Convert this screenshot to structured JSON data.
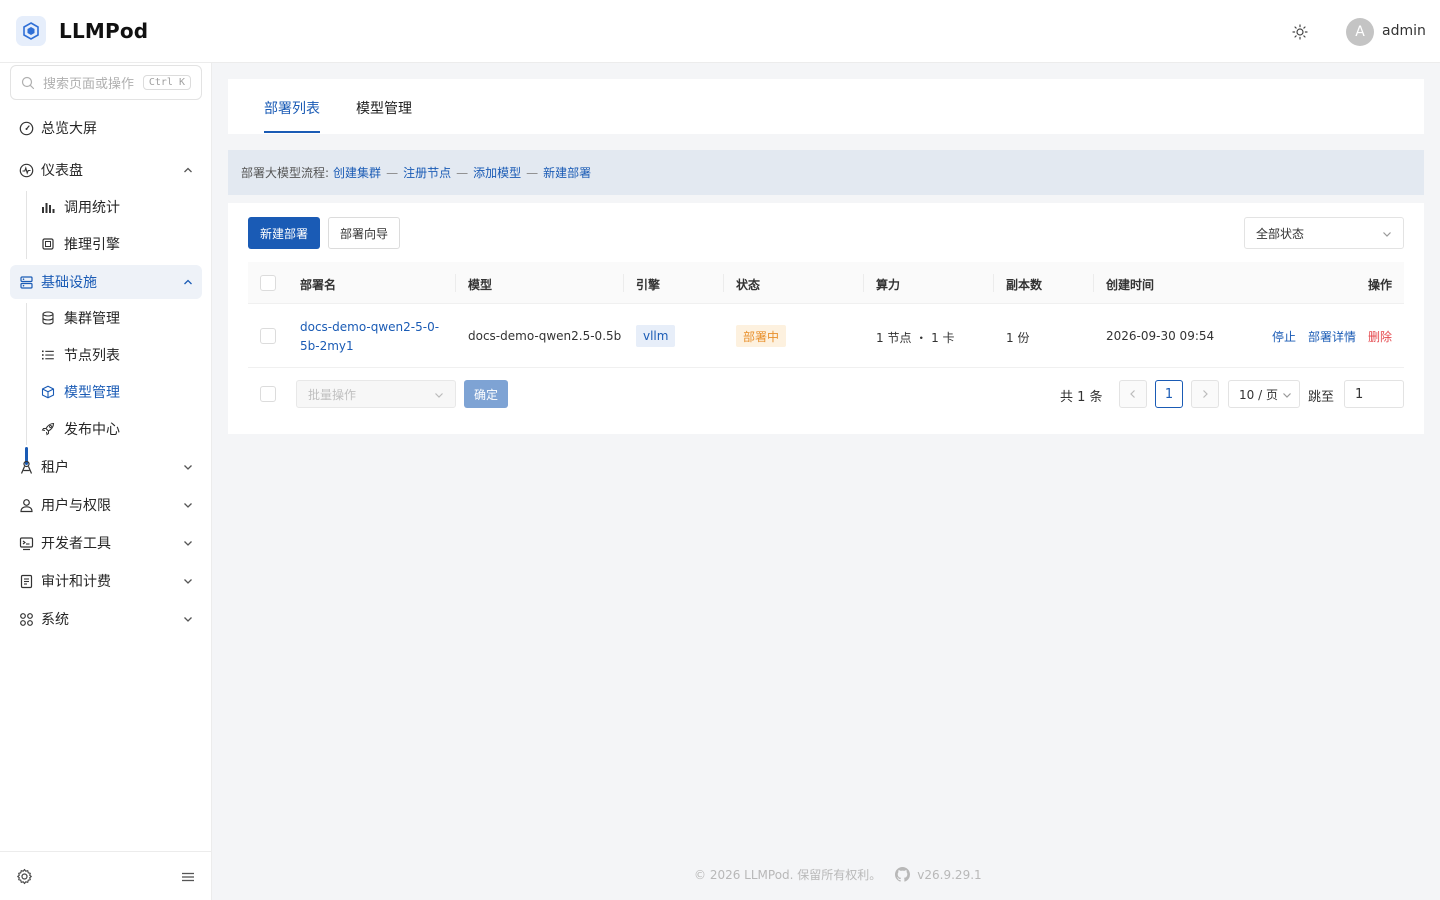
{
  "app": {
    "title": "LLMPod",
    "user_initial": "A",
    "username": "admin"
  },
  "search": {
    "placeholder": "搜索页面或操作",
    "shortcut": "Ctrl K"
  },
  "sidebar": {
    "overview": "总览大屏",
    "dashboard": {
      "label": "仪表盘",
      "children": [
        "调用统计",
        "推理引擎"
      ]
    },
    "infra": {
      "label": "基础设施",
      "children": [
        "集群管理",
        "节点列表",
        "模型管理",
        "发布中心"
      ]
    },
    "tenant": "租户",
    "users": "用户与权限",
    "devtools": "开发者工具",
    "audit": "审计和计费",
    "system": "系统"
  },
  "tabs": [
    "部署列表",
    "模型管理"
  ],
  "flow": {
    "prefix": "部署大模型流程:",
    "steps": [
      "创建集群",
      "注册节点",
      "添加模型",
      "新建部署"
    ],
    "separator": "—"
  },
  "toolbar": {
    "new_deploy": "新建部署",
    "wizard": "部署向导",
    "status_filter": "全部状态"
  },
  "table": {
    "headers": [
      "部署名",
      "模型",
      "引擎",
      "状态",
      "算力",
      "副本数",
      "创建时间",
      "操作"
    ],
    "rows": [
      {
        "name": "docs-demo-qwen2-5-0-5b-2my1",
        "name_line1": "docs-demo-qwen2-5-0-",
        "name_line2": "5b-2my1",
        "model": "docs-demo-qwen2.5-0.5b",
        "engine": "vllm",
        "status": "部署中",
        "compute": "1 节点 ・ 1 卡",
        "replicas": "1 份",
        "created": "2026-09-30 09:54",
        "actions": [
          "停止",
          "部署详情",
          "删除"
        ]
      }
    ]
  },
  "bulk": {
    "placeholder": "批量操作",
    "confirm": "确定"
  },
  "pagination": {
    "total": "共 1 条",
    "current": "1",
    "page_size": "10 / 页",
    "jump_label": "跳至",
    "jump_value": "1"
  },
  "footer": {
    "copyright": "© 2026 LLMPod. 保留所有权利。",
    "version": "v26.9.29.1"
  },
  "colors": {
    "primary": "#1a5bb5",
    "warning": "#e8902c",
    "danger": "#e5484d"
  }
}
